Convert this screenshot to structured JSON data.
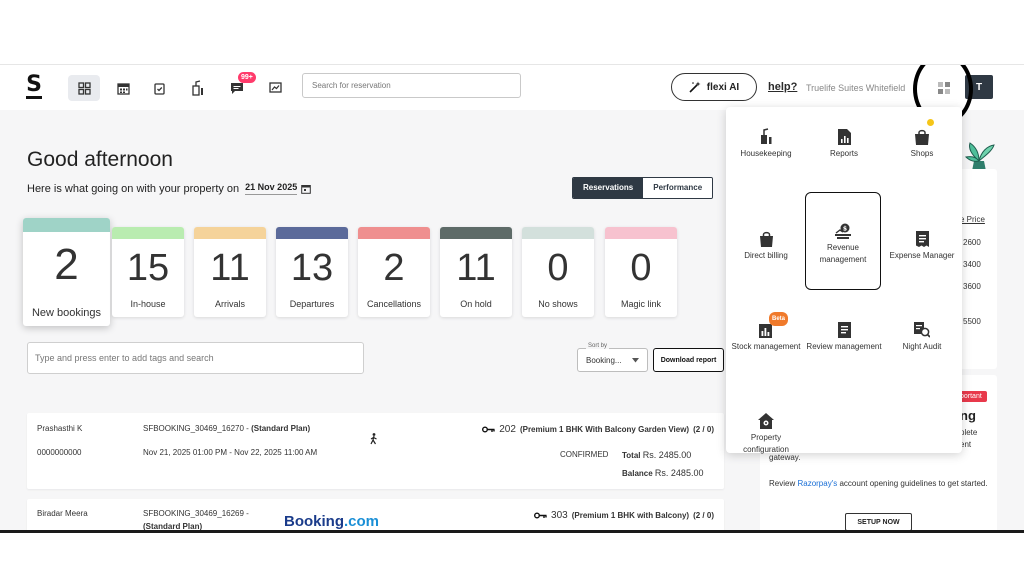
{
  "nav": {
    "logo": "S",
    "notification_badge": "99+",
    "search_placeholder": "Search for reservation",
    "flexi_label": "flexi AI",
    "help_label": "help?",
    "property_name": "Truelife Suites Whitefield",
    "avatar_initial": "T"
  },
  "header": {
    "greeting": "Good afternoon",
    "subtitle": "Here is what going on with your property on",
    "date": "21 Nov 2025",
    "tabs": [
      "Reservations",
      "Performance"
    ]
  },
  "stats": [
    {
      "value": "2",
      "label": "New bookings",
      "color": "#9fd3c7"
    },
    {
      "value": "15",
      "label": "In-house",
      "color": "#b9ecb0"
    },
    {
      "value": "11",
      "label": "Arrivals",
      "color": "#f5d39a"
    },
    {
      "value": "13",
      "label": "Departures",
      "color": "#5b6a9a"
    },
    {
      "value": "2",
      "label": "Cancellations",
      "color": "#ef8f8f"
    },
    {
      "value": "11",
      "label": "On hold",
      "color": "#5e6b68"
    },
    {
      "value": "0",
      "label": "No shows",
      "color": "#d3e0dc"
    },
    {
      "value": "0",
      "label": "Magic link",
      "color": "#f7c2cf"
    }
  ],
  "filters": {
    "tag_placeholder": "Type and press enter to add tags and search",
    "sort_label": "Sort by",
    "sort_value": "Booking...",
    "download_label": "Download report"
  },
  "bookings": [
    {
      "guest": "Prashasthi K",
      "phone": "0000000000",
      "booking_id": "SFBOOKING_30469_16270 - ",
      "plan": "(Standard Plan)",
      "dates": "Nov 21, 2025 01:00 PM - Nov 22, 2025 11:00 AM",
      "room_no": "202",
      "room_type": "(Premium 1 BHK With Balcony Garden View)",
      "room_count": "(2 / 0)",
      "status": "CONFIRMED",
      "total_label": "Total",
      "total": "Rs. 2485.00",
      "balance_label": "Balance",
      "balance": "Rs. 2485.00"
    },
    {
      "guest": "Biradar Meera",
      "booking_id": "SFBOOKING_30469_16269 -",
      "plan": "(Standard Plan)",
      "source_logo_a": "Booking",
      "source_logo_b": ".com",
      "room_no": "303",
      "room_type": "(Premium 1 BHK with Balcony)",
      "room_count": "(2 / 0)"
    }
  ],
  "right_panel": {
    "link": "e Price",
    "values": [
      "2600",
      "3400",
      "3600",
      "5500"
    ],
    "tag": "portant",
    "heading": "ng",
    "line1": "plete",
    "line2": "ent",
    "line3": "gateway.",
    "review_prefix": "Review",
    "review_link": "Razorpay's",
    "review_suffix": "account opening guidelines to get started.",
    "setup_label": "SETUP NOW"
  },
  "menu": {
    "items": [
      {
        "label": "Housekeeping",
        "icon": "housekeeping-icon"
      },
      {
        "label": "Reports",
        "icon": "reports-icon"
      },
      {
        "label": "Shops",
        "icon": "shops-icon"
      },
      {
        "label": "Direct billing",
        "icon": "direct-billing-icon"
      },
      {
        "label": "Revenue management",
        "icon": "revenue-management-icon"
      },
      {
        "label": "Expense Manager",
        "icon": "expense-manager-icon"
      },
      {
        "label": "Stock management",
        "icon": "stock-management-icon",
        "badge": "Beta"
      },
      {
        "label": "Review management",
        "icon": "review-management-icon"
      },
      {
        "label": "Night Audit",
        "icon": "night-audit-icon"
      },
      {
        "label": "Property configuration",
        "icon": "property-configuration-icon"
      }
    ]
  },
  "colors": {
    "dark": "#2f3944",
    "badge": "#ff3b6b",
    "beta": "#f07a2b",
    "link": "#1a6fd6"
  }
}
